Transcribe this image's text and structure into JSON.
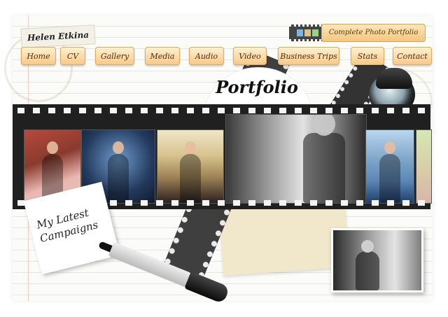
{
  "header": {
    "site_name": "Helen Etkina",
    "portfolio_button": "Complete Photo Portfolio"
  },
  "nav": {
    "items": [
      {
        "label": "Home"
      },
      {
        "label": "CV"
      },
      {
        "label": "Gallery"
      },
      {
        "label": "Media"
      },
      {
        "label": "Audio"
      },
      {
        "label": "Video"
      },
      {
        "label": "Business Trips"
      },
      {
        "label": "Stats"
      },
      {
        "label": "Contact"
      }
    ]
  },
  "main": {
    "title": "Portfolio",
    "note_lines": [
      "My Latest",
      "Campaigns"
    ]
  },
  "colors": {
    "nav_bg": "#f7c98a",
    "film": "#202020",
    "envelope": "#f1e7cb"
  },
  "icons": {
    "lens": "camera-lens-icon",
    "marker": "marker-icon"
  }
}
